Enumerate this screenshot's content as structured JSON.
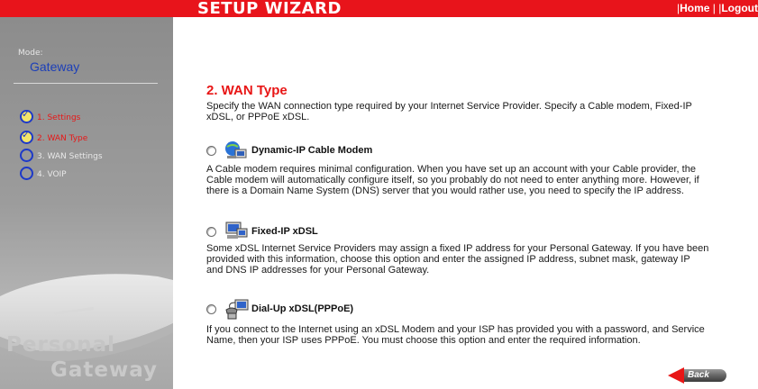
{
  "header": {
    "title": "SETUP WIZARD",
    "links": {
      "sep1": "|",
      "home": "Home",
      "sep2": " |",
      "logout": "Logout"
    }
  },
  "sidebar": {
    "mode_label": "Mode:",
    "mode_value": "Gateway",
    "steps": [
      {
        "label": "1. Settings",
        "state": "done"
      },
      {
        "label": "2. WAN Type",
        "state": "current"
      },
      {
        "label": "3. WAN Settings",
        "state": "pending"
      },
      {
        "label": "4. VOIP",
        "state": "pending"
      }
    ],
    "brand_line1": "Personal",
    "brand_line2": "Gateway"
  },
  "main": {
    "heading": "2. WAN Type",
    "intro_line1": "Specify the WAN connection type required by your Internet Service Provider. Specify a Cable modem, Fixed-IP",
    "intro_line2": "xDSL, or PPPoE xDSL.",
    "options": [
      {
        "label": "Dynamic-IP Cable Modem",
        "icon": "cable-modem-icon",
        "desc": [
          "A Cable modem requires minimal configuration. When you have set up an account with your Cable provider, the",
          "Cable modem will automatically configure itself, so you probably do not need to enter anything more. However, if",
          "there is a Domain Name System (DNS) server that you would rather use, you need to specify the IP address."
        ]
      },
      {
        "label": "Fixed-IP xDSL",
        "icon": "fixed-ip-computer-icon",
        "desc": [
          "Some xDSL Internet Service Providers may assign a fixed IP address for your Personal Gateway. If you have been",
          "provided with this information, choose this option and enter the assigned IP address, subnet mask, gateway IP",
          "and DNS IP addresses for your Personal Gateway."
        ]
      },
      {
        "label": "Dial-Up xDSL(PPPoE)",
        "icon": "dialup-phone-computer-icon",
        "desc": [
          "If you connect to the Internet using an xDSL Modem and your ISP has provided you with a password, and Service",
          "Name, then your ISP uses PPPoE. You must choose this option and enter the required information."
        ]
      }
    ],
    "back_label": "Back"
  },
  "colors": {
    "header_red": "#e8141b",
    "heading_red": "#e81616",
    "step_blue": "#1d39c8",
    "mode_blue": "#1c3fb8"
  }
}
